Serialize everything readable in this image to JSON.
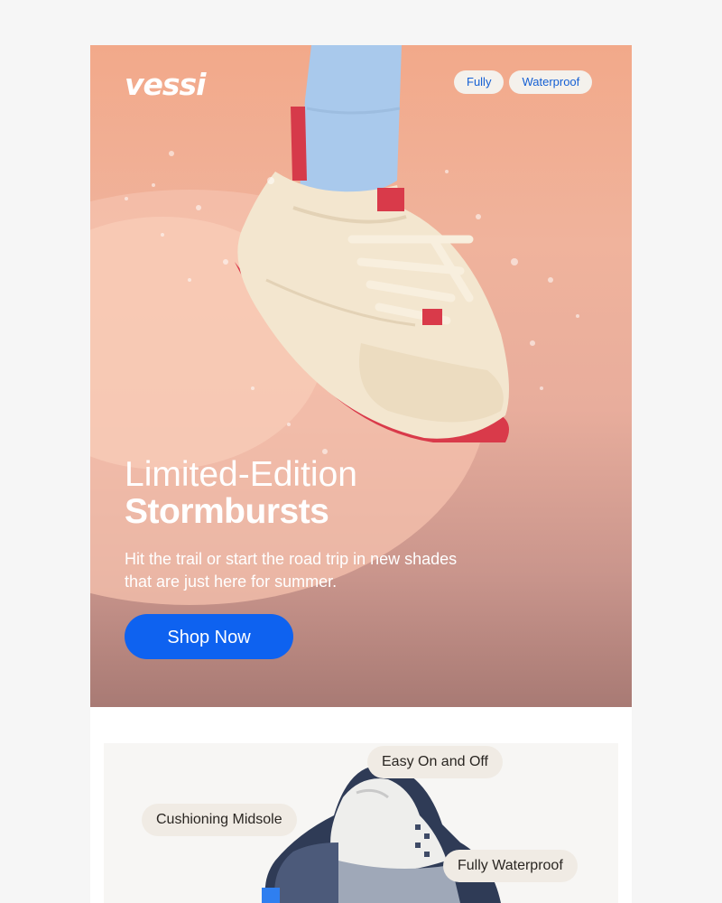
{
  "brand": {
    "logo_text": "vessi"
  },
  "hero": {
    "badges": [
      "Fully",
      "Waterproof"
    ],
    "headline_line1": "Limited-Edition",
    "headline_line2": "Stormbursts",
    "subcopy": "Hit the trail or start the road trip in new shades that are just here for summer.",
    "cta_label": "Shop Now",
    "image_alt": "shoe-photo"
  },
  "features": {
    "chips": [
      "Easy On and Off",
      "Cushioning Midsole",
      "Fully Waterproof"
    ]
  },
  "colors": {
    "cta": "#0e62f0",
    "badge_text": "#1560d4",
    "hero_bg": "#f2a98a",
    "chip_bg": "#f0ebe4"
  }
}
